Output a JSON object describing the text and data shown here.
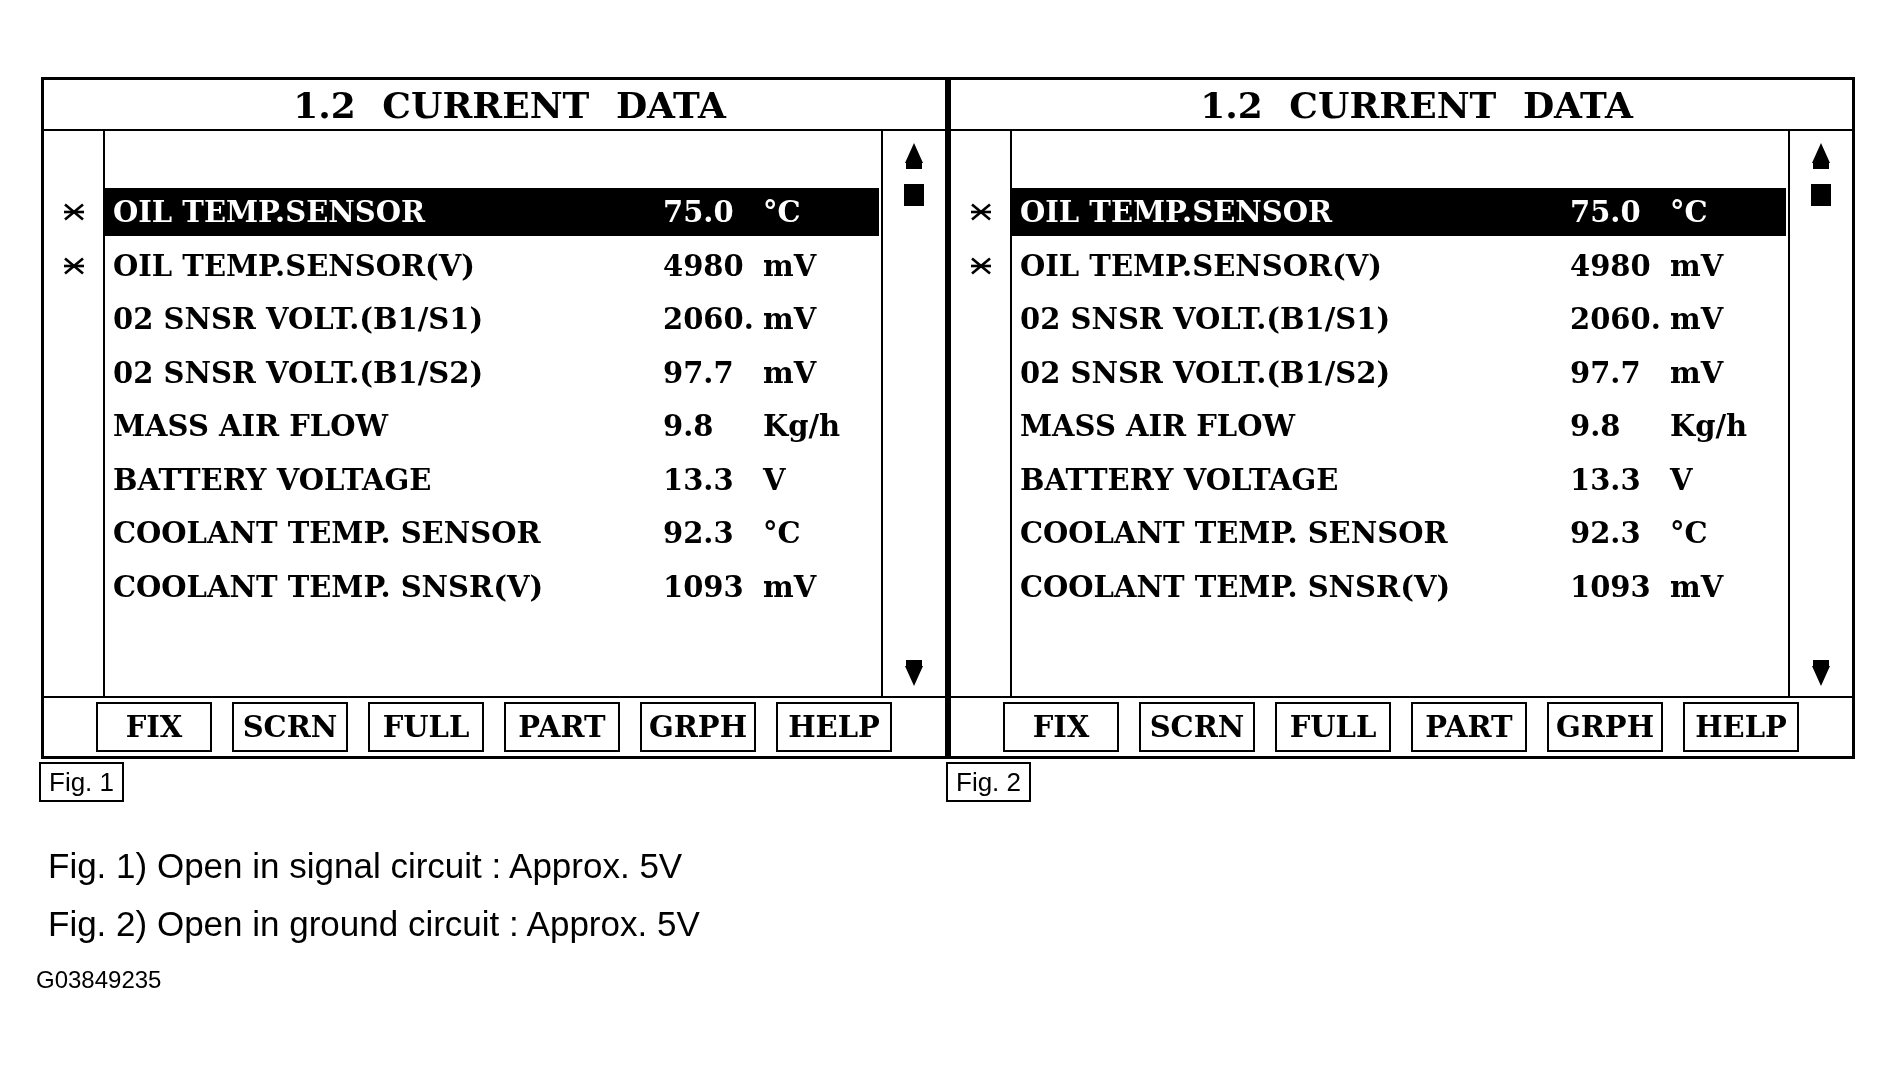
{
  "panels": [
    {
      "title": "1.2 CURRENT DATA",
      "rows": [
        {
          "name": "OIL TEMP.SENSOR",
          "value": "75.0",
          "unit": "°C",
          "marked": true,
          "selected": true
        },
        {
          "name": "OIL TEMP.SENSOR(V)",
          "value": "4980",
          "unit": "mV",
          "marked": true,
          "selected": false
        },
        {
          "name": "02 SNSR VOLT.(B1/S1)",
          "value": "2060.",
          "unit": "mV",
          "marked": false,
          "selected": false
        },
        {
          "name": "02 SNSR VOLT.(B1/S2)",
          "value": "97.7",
          "unit": "mV",
          "marked": false,
          "selected": false
        },
        {
          "name": "MASS AIR FLOW",
          "value": "9.8",
          "unit": "Kg/h",
          "marked": false,
          "selected": false
        },
        {
          "name": "BATTERY VOLTAGE",
          "value": "13.3",
          "unit": "V",
          "marked": false,
          "selected": false
        },
        {
          "name": "COOLANT TEMP. SENSOR",
          "value": "92.3",
          "unit": "°C",
          "marked": false,
          "selected": false
        },
        {
          "name": "COOLANT TEMP. SNSR(V)",
          "value": "1093",
          "unit": "mV",
          "marked": false,
          "selected": false
        }
      ],
      "buttons": [
        "FIX",
        "SCRN",
        "FULL",
        "PART",
        "GRPH",
        "HELP"
      ],
      "figure_label": "Fig. 1"
    },
    {
      "title": "1.2 CURRENT DATA",
      "rows": [
        {
          "name": "OIL TEMP.SENSOR",
          "value": "75.0",
          "unit": "°C",
          "marked": true,
          "selected": true
        },
        {
          "name": "OIL TEMP.SENSOR(V)",
          "value": "4980",
          "unit": "mV",
          "marked": true,
          "selected": false
        },
        {
          "name": "02 SNSR VOLT.(B1/S1)",
          "value": "2060.",
          "unit": "mV",
          "marked": false,
          "selected": false
        },
        {
          "name": "02 SNSR VOLT.(B1/S2)",
          "value": "97.7",
          "unit": "mV",
          "marked": false,
          "selected": false
        },
        {
          "name": "MASS AIR FLOW",
          "value": "9.8",
          "unit": "Kg/h",
          "marked": false,
          "selected": false
        },
        {
          "name": "BATTERY VOLTAGE",
          "value": "13.3",
          "unit": "V",
          "marked": false,
          "selected": false
        },
        {
          "name": "COOLANT TEMP. SENSOR",
          "value": "92.3",
          "unit": "°C",
          "marked": false,
          "selected": false
        },
        {
          "name": "COOLANT TEMP. SNSR(V)",
          "value": "1093",
          "unit": "mV",
          "marked": false,
          "selected": false
        }
      ],
      "buttons": [
        "FIX",
        "SCRN",
        "FULL",
        "PART",
        "GRPH",
        "HELP"
      ],
      "figure_label": "Fig. 2"
    }
  ],
  "captions": [
    "Fig. 1) Open in signal circuit : Approx. 5V",
    "Fig. 2) Open in ground circuit : Approx. 5V"
  ],
  "figure_id": "G03849235"
}
